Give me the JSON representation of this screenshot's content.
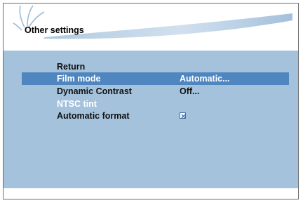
{
  "header": {
    "title": "Other settings",
    "logo_icon": "swoosh-logo-icon",
    "accent": "#4f86c0"
  },
  "menu": {
    "items": [
      {
        "label": "Return",
        "value": "",
        "state": "normal"
      },
      {
        "label": "Film mode",
        "value": "Automatic...",
        "state": "selected"
      },
      {
        "label": "Dynamic Contrast",
        "value": "Off...",
        "state": "normal"
      },
      {
        "label": "NTSC tint",
        "value": "",
        "state": "disabled"
      },
      {
        "label": "Automatic format",
        "value": "",
        "state": "normal",
        "checked": true,
        "control_icon": "checkbox-checked-icon"
      }
    ]
  },
  "colors": {
    "panel_bg": "#a5c2dc",
    "selection_bg": "#4f86c0",
    "disabled_text": "#ffffff"
  }
}
